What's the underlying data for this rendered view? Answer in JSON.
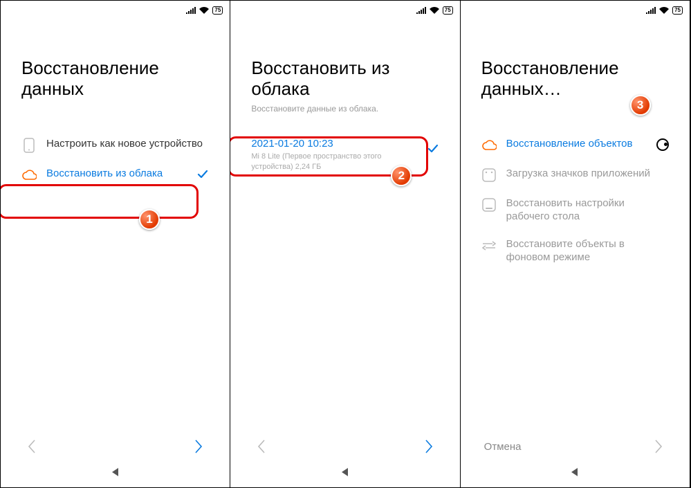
{
  "status": {
    "battery_pct": "75"
  },
  "badges": {
    "one": "1",
    "two": "2",
    "three": "3"
  },
  "panel1": {
    "title": "Восстановление данных",
    "options": [
      {
        "label": "Настроить как новое устройство"
      },
      {
        "label": "Восстановить из облака"
      }
    ]
  },
  "panel2": {
    "title": "Восстановить из облака",
    "subtitle": "Восстановите данные из облака.",
    "backup": {
      "timestamp": "2021-01-20 10:23",
      "device_line": "Mi 8 Lite (Первое пространство этого устройства) 2,24 ГБ"
    }
  },
  "panel3": {
    "title": "Восстановление данных…",
    "cancel_label": "Отмена",
    "items": [
      {
        "label": "Восстановление объектов"
      },
      {
        "label": "Загрузка значков приложений"
      },
      {
        "label": "Восстановить настройки рабочего стола"
      },
      {
        "label": "Восстановите объекты в фоновом режиме"
      }
    ]
  }
}
